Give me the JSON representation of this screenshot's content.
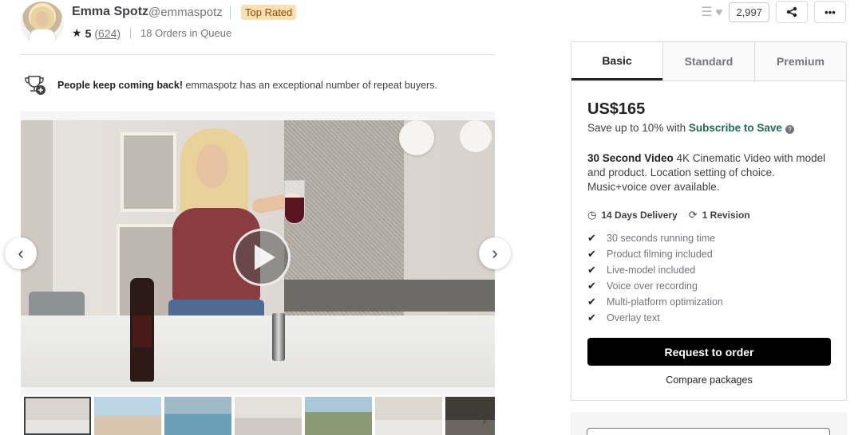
{
  "seller": {
    "name": "Emma Spotz",
    "handle": "@emmaspotz",
    "badge": "Top Rated",
    "rating": "5",
    "review_count": "(624)",
    "queue": "18 Orders in Queue"
  },
  "repeat": {
    "bold": "People keep coming back!",
    "text": " emmaspotz has an exceptional number of repeat buyers."
  },
  "actions": {
    "likes": "2,997"
  },
  "packages": {
    "tabs": [
      "Basic",
      "Standard",
      "Premium"
    ],
    "active_tab": "Basic",
    "price": "US$165",
    "save_prefix": "Save up to 10% with ",
    "save_link": "Subscribe to Save",
    "desc_title": "30 Second Video",
    "desc_body": " 4K Cinematic Video with model and product. Location setting of choice. Music+voice over available.",
    "delivery": "14 Days Delivery",
    "revisions": "1 Revision",
    "features": [
      "30 seconds running time",
      "Product filming included",
      "Live-model included",
      "Voice over recording",
      "Multi-platform optimization",
      "Overlay text"
    ],
    "order_button": "Request to order",
    "compare_link": "Compare packages"
  },
  "colors": {
    "subscribe_green": "#1d6b4f",
    "badge_bg": "#ffe0b3",
    "badge_text": "#8a4b00"
  },
  "icons": [
    "star-icon",
    "trophy-icon",
    "play-icon",
    "chevron-left-icon",
    "chevron-right-icon",
    "list-icon",
    "heart-icon",
    "share-icon",
    "more-icon",
    "clock-icon",
    "refresh-icon",
    "check-icon",
    "help-icon"
  ]
}
